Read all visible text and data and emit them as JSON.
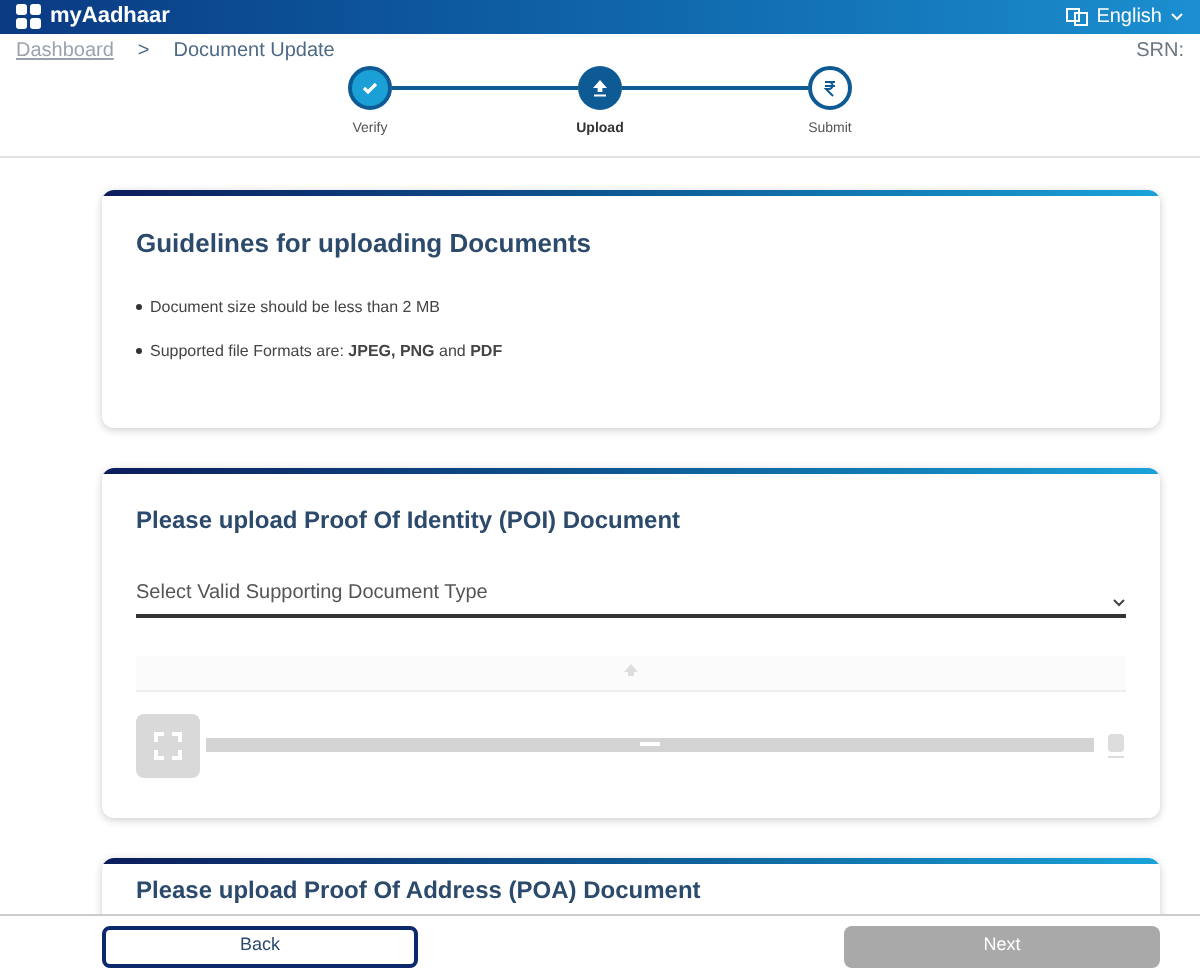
{
  "header": {
    "brand": "myAadhaar",
    "language": "English"
  },
  "breadcrumb": [
    {
      "label": "Dashboard",
      "link": true
    },
    {
      "label": ">",
      "link": false
    },
    {
      "label": "Document Update",
      "link": false
    }
  ],
  "srn": "SRN:",
  "steps": [
    {
      "label": "Verify",
      "kind": "done"
    },
    {
      "label": "Upload",
      "kind": "current"
    },
    {
      "label": "Submit",
      "kind": "pending"
    }
  ],
  "guidelines": {
    "title": "Guidelines for uploading Documents",
    "items": [
      "Document size should be less than 2 MB",
      "Supported file Formats are: **JPEG, PNG** and **PDF**"
    ]
  },
  "poi": {
    "title": "Please upload Proof Of Identity (POI) Document",
    "placeholder": "Select Valid Supporting Document Type",
    "upload_disabled": true,
    "zoom": {
      "level": 0.5
    }
  },
  "poa": {
    "title": "Please upload Proof Of Address (POA) Document"
  },
  "footer": {
    "back": "Back",
    "next": "Next",
    "next_disabled": true
  }
}
